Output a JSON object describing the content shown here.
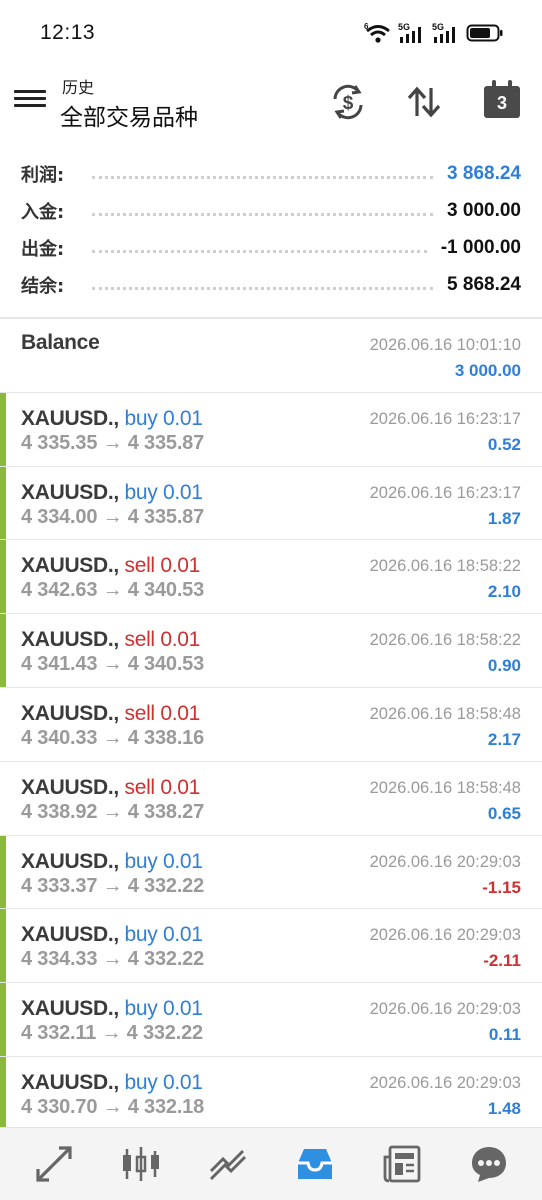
{
  "status_bar": {
    "time": "12:13",
    "wifi_badge": "6",
    "sim1": "5G",
    "sim2": "5G"
  },
  "header": {
    "subtitle": "历史",
    "title": "全部交易品种",
    "calendar_day": "3",
    "icons": [
      "currency-exchange-icon",
      "sort-icon",
      "calendar-icon"
    ]
  },
  "summary": {
    "profit": {
      "label": "利润:",
      "value": "3 868.24",
      "color": "#2f7fd6"
    },
    "deposit": {
      "label": "入金:",
      "value": "3 000.00"
    },
    "withdrawal": {
      "label": "出金:",
      "value": "-1 000.00"
    },
    "balance": {
      "label": "结余:",
      "value": "5 868.24"
    }
  },
  "balance_entry": {
    "label": "Balance",
    "datetime": "2026.06.16 10:01:10",
    "amount": "3 000.00"
  },
  "trades": [
    {
      "symbol": "XAUUSD.,",
      "side": " buy 0.01",
      "type": "buy",
      "prices": "4 335.35 → 4 335.87",
      "datetime": "2026.06.16 16:23:17",
      "profit": "0.52",
      "marked": true
    },
    {
      "symbol": "XAUUSD.,",
      "side": " buy 0.01",
      "type": "buy",
      "prices": "4 334.00 → 4 335.87",
      "datetime": "2026.06.16 16:23:17",
      "profit": "1.87",
      "marked": true
    },
    {
      "symbol": "XAUUSD.,",
      "side": " sell 0.01",
      "type": "sell",
      "prices": "4 342.63 → 4 340.53",
      "datetime": "2026.06.16 18:58:22",
      "profit": "2.10",
      "marked": true
    },
    {
      "symbol": "XAUUSD.,",
      "side": " sell 0.01",
      "type": "sell",
      "prices": "4 341.43 → 4 340.53",
      "datetime": "2026.06.16 18:58:22",
      "profit": "0.90",
      "marked": true
    },
    {
      "symbol": "XAUUSD.,",
      "side": " sell 0.01",
      "type": "sell",
      "prices": "4 340.33 → 4 338.16",
      "datetime": "2026.06.16 18:58:48",
      "profit": "2.17",
      "marked": false
    },
    {
      "symbol": "XAUUSD.,",
      "side": " sell 0.01",
      "type": "sell",
      "prices": "4 338.92 → 4 338.27",
      "datetime": "2026.06.16 18:58:48",
      "profit": "0.65",
      "marked": false
    },
    {
      "symbol": "XAUUSD.,",
      "side": " buy 0.01",
      "type": "buy",
      "prices": "4 333.37 → 4 332.22",
      "datetime": "2026.06.16 20:29:03",
      "profit": "-1.15",
      "marked": true
    },
    {
      "symbol": "XAUUSD.,",
      "side": " buy 0.01",
      "type": "buy",
      "prices": "4 334.33 → 4 332.22",
      "datetime": "2026.06.16 20:29:03",
      "profit": "-2.11",
      "marked": true
    },
    {
      "symbol": "XAUUSD.,",
      "side": " buy 0.01",
      "type": "buy",
      "prices": "4 332.11 → 4 332.22",
      "datetime": "2026.06.16 20:29:03",
      "profit": "0.11",
      "marked": true
    },
    {
      "symbol": "XAUUSD.,",
      "side": " buy 0.01",
      "type": "buy",
      "prices": "4 330.70 → 4 332.18",
      "datetime": "2026.06.16 20:29:03",
      "profit": "1.48",
      "marked": true
    }
  ],
  "colors": {
    "buy": "#2f7fd6",
    "sell": "#cf3030",
    "positive": "#2f7fd6",
    "negative": "#cf3030",
    "marker": "#8ab83a",
    "nav_active": "#2f8fe0"
  },
  "bottom_nav": {
    "items": [
      "quotes-icon",
      "chart-icon",
      "trade-icon",
      "history-icon",
      "news-icon",
      "chat-icon"
    ],
    "active": "history-icon"
  }
}
